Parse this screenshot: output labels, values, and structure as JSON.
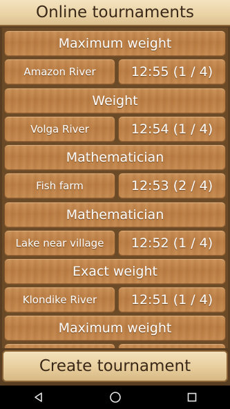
{
  "header": {
    "title": "Online tournaments"
  },
  "tournaments": [
    {
      "type": "Maximum weight",
      "location": "Amazon River",
      "status": "12:55 (1 / 4)"
    },
    {
      "type": "Weight",
      "location": "Volga River",
      "status": "12:54 (1 / 4)"
    },
    {
      "type": "Mathematician",
      "location": "Fish farm",
      "status": "12:53 (2 / 4)"
    },
    {
      "type": "Mathematician",
      "location": "Lake near village",
      "status": "12:52 (1 / 4)"
    },
    {
      "type": "Exact weight",
      "location": "Klondike River",
      "status": "12:51 (1 / 4)"
    },
    {
      "type": "Maximum weight",
      "location": "",
      "status": ""
    }
  ],
  "footer": {
    "create_label": "Create tournament"
  },
  "navbar": {
    "icons": [
      "back-icon",
      "home-icon",
      "recents-icon"
    ]
  }
}
